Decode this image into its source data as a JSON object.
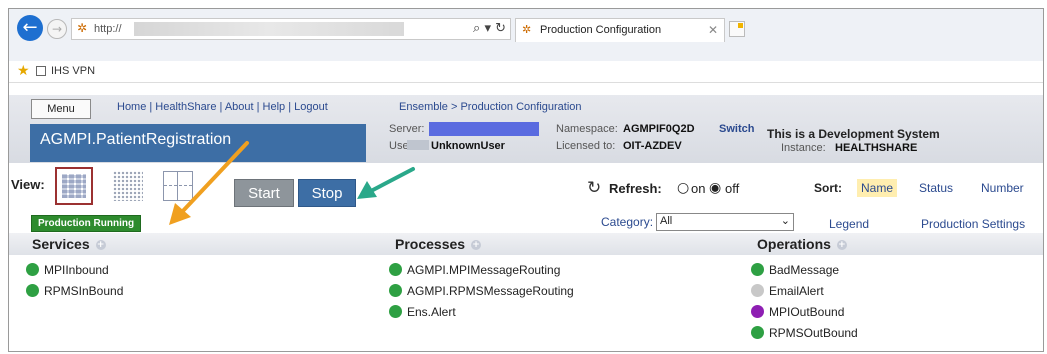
{
  "browser": {
    "url_prefix": "http://",
    "tab_title": "Production Configuration",
    "favorite": "IHS VPN",
    "addr_controls": "⌕ ▾ ↻"
  },
  "header": {
    "menu": "Menu",
    "links": "Home | HealthShare | About | Help | Logout",
    "breadcrumb": "Ensemble > Production Configuration",
    "production_name": "AGMPI.PatientRegistration",
    "server_label": "Server:",
    "user_label": "User:",
    "user_value": "UnknownUser",
    "namespace_label": "Namespace:",
    "namespace_value": "AGMPIF0Q2D",
    "switch": "Switch",
    "licensed_label": "Licensed to:",
    "licensed_value": "OIT-AZDEV",
    "dev_system": "This is a Development System",
    "instance_label": "Instance:",
    "instance_value": "HEALTHSHARE"
  },
  "toolbar": {
    "view_label": "View:",
    "start": "Start",
    "stop": "Stop",
    "refresh_label": "Refresh:",
    "refresh_on": "on",
    "refresh_off": "off",
    "refresh_selected": "off",
    "sort_label": "Sort:",
    "sort_options": [
      "Name",
      "Status",
      "Number"
    ],
    "sort_selected": "Name"
  },
  "status": {
    "production_running": "Production Running",
    "category_label": "Category:",
    "category_value": "All",
    "legend": "Legend",
    "settings": "Production Settings"
  },
  "columns": {
    "services": {
      "title": "Services",
      "items": [
        {
          "name": "MPIInbound",
          "status_color": "#2ea043"
        },
        {
          "name": "RPMSInBound",
          "status_color": "#2ea043"
        }
      ]
    },
    "processes": {
      "title": "Processes",
      "items": [
        {
          "name": "AGMPI.MPIMessageRouting",
          "status_color": "#2ea043"
        },
        {
          "name": "AGMPI.RPMSMessageRouting",
          "status_color": "#2ea043"
        },
        {
          "name": "Ens.Alert",
          "status_color": "#2ea043"
        }
      ]
    },
    "operations": {
      "title": "Operations",
      "items": [
        {
          "name": "BadMessage",
          "status_color": "#2ea043"
        },
        {
          "name": "EmailAlert",
          "status_color": "#c8c8c8"
        },
        {
          "name": "MPIOutBound",
          "status_color": "#8e1fb3"
        },
        {
          "name": "RPMSOutBound",
          "status_color": "#2ea043"
        }
      ]
    }
  },
  "annotation_colors": {
    "orange_arrow": "#f0a020",
    "teal_arrow": "#2aa88a"
  }
}
